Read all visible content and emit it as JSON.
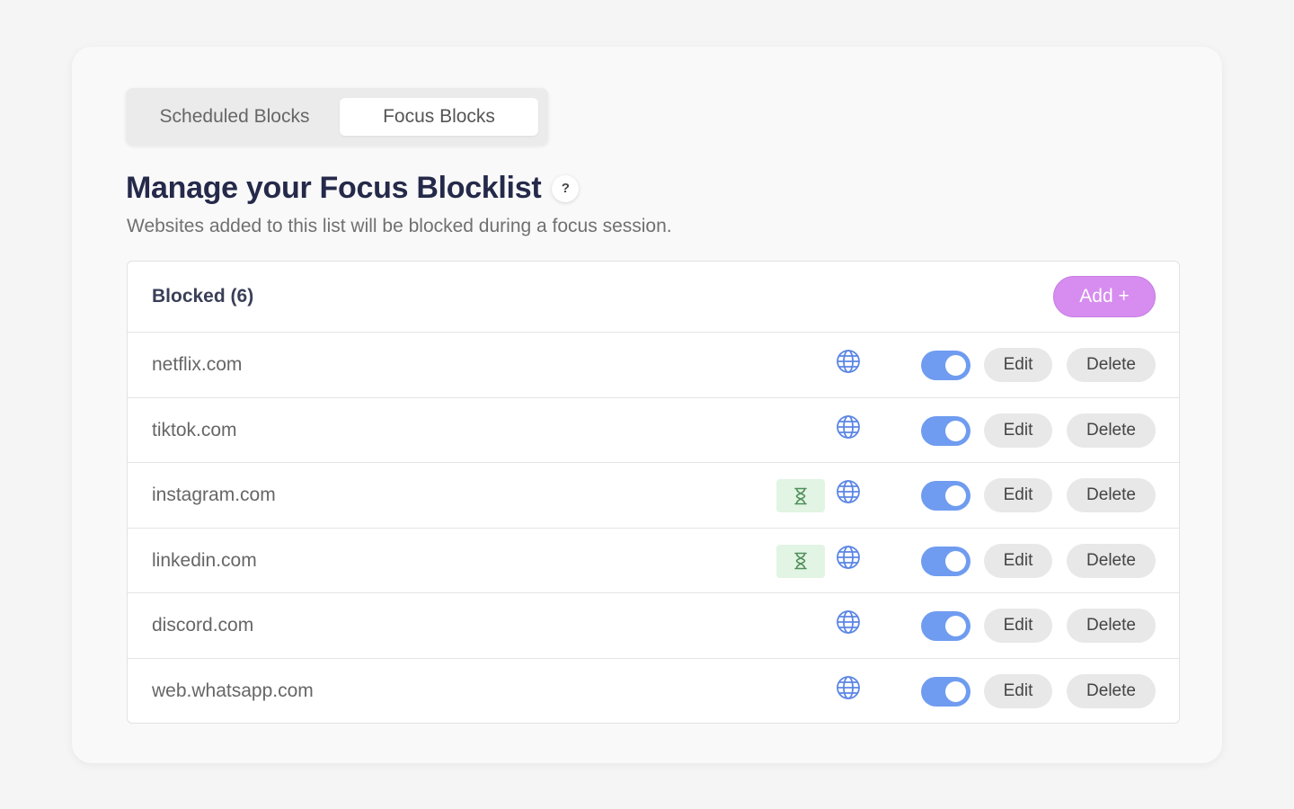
{
  "tabs": [
    {
      "label": "Scheduled Blocks",
      "active": false
    },
    {
      "label": "Focus Blocks",
      "active": true
    }
  ],
  "header": {
    "title": "Manage your Focus Blocklist",
    "help_label": "?",
    "subtitle": "Websites added to this list will be blocked during a focus session."
  },
  "list": {
    "heading": "Blocked (6)",
    "add_label": "Add +",
    "edit_label": "Edit",
    "delete_label": "Delete",
    "rows": [
      {
        "domain": "netflix.com",
        "timer": false,
        "enabled": true
      },
      {
        "domain": "tiktok.com",
        "timer": false,
        "enabled": true
      },
      {
        "domain": "instagram.com",
        "timer": true,
        "enabled": true
      },
      {
        "domain": "linkedin.com",
        "timer": true,
        "enabled": true
      },
      {
        "domain": "discord.com",
        "timer": false,
        "enabled": true
      },
      {
        "domain": "web.whatsapp.com",
        "timer": false,
        "enabled": true
      }
    ]
  },
  "colors": {
    "accent_add": "#d78cf0",
    "toggle_on": "#6f9cf0",
    "timer_bg": "#e2f4e3",
    "title": "#252a4a"
  },
  "icons": {
    "row_site": "globe-icon",
    "row_timer": "hourglass-icon"
  }
}
